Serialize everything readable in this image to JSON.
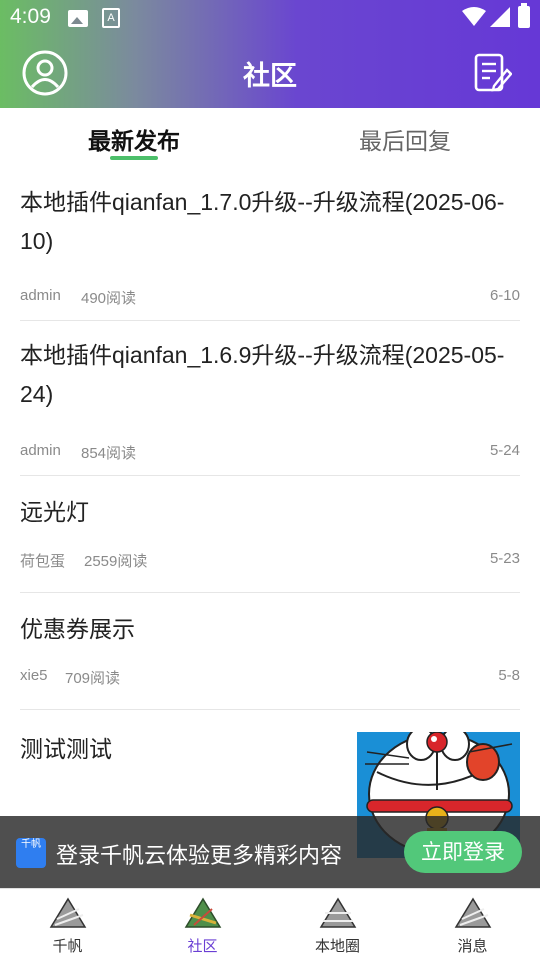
{
  "status_bar": {
    "time": "4:09",
    "a_icon_text": "A"
  },
  "header": {
    "title": "社区"
  },
  "tabs": [
    {
      "label": "最新发布",
      "active": true
    },
    {
      "label": "最后回复",
      "active": false
    }
  ],
  "posts": [
    {
      "title": "本地插件qianfan_1.7.0升级--升级流程(2025-06-10)",
      "author": "admin",
      "reads": "490阅读",
      "date": "6-10"
    },
    {
      "title": "本地插件qianfan_1.6.9升级--升级流程(2025-05-24)",
      "author": "admin",
      "reads": "854阅读",
      "date": "5-24"
    },
    {
      "title": "远光灯",
      "author": "荷包蛋",
      "reads": "2559阅读",
      "date": "5-23"
    },
    {
      "title": "优惠券展示",
      "author": "xie5",
      "reads": "709阅读",
      "date": "5-8"
    },
    {
      "title": "测试测试"
    }
  ],
  "login_banner": {
    "logo_text": "千帆",
    "text": "登录千帆云体验更多精彩内容",
    "button": "立即登录"
  },
  "bottom_nav": [
    {
      "label": "千帆",
      "icon": "rice-dumpling-icon",
      "active": false
    },
    {
      "label": "社区",
      "icon": "rice-dumpling-icon",
      "active": true
    },
    {
      "label": "本地圈",
      "icon": "rice-dumpling-icon",
      "active": false
    },
    {
      "label": "消息",
      "icon": "rice-dumpling-icon",
      "active": false
    }
  ],
  "colors": {
    "header_gradient_start": "#6bbd63",
    "header_gradient_end": "#6638d6",
    "accent_green": "#4cbf6a",
    "active_nav": "#6a3fd4"
  }
}
